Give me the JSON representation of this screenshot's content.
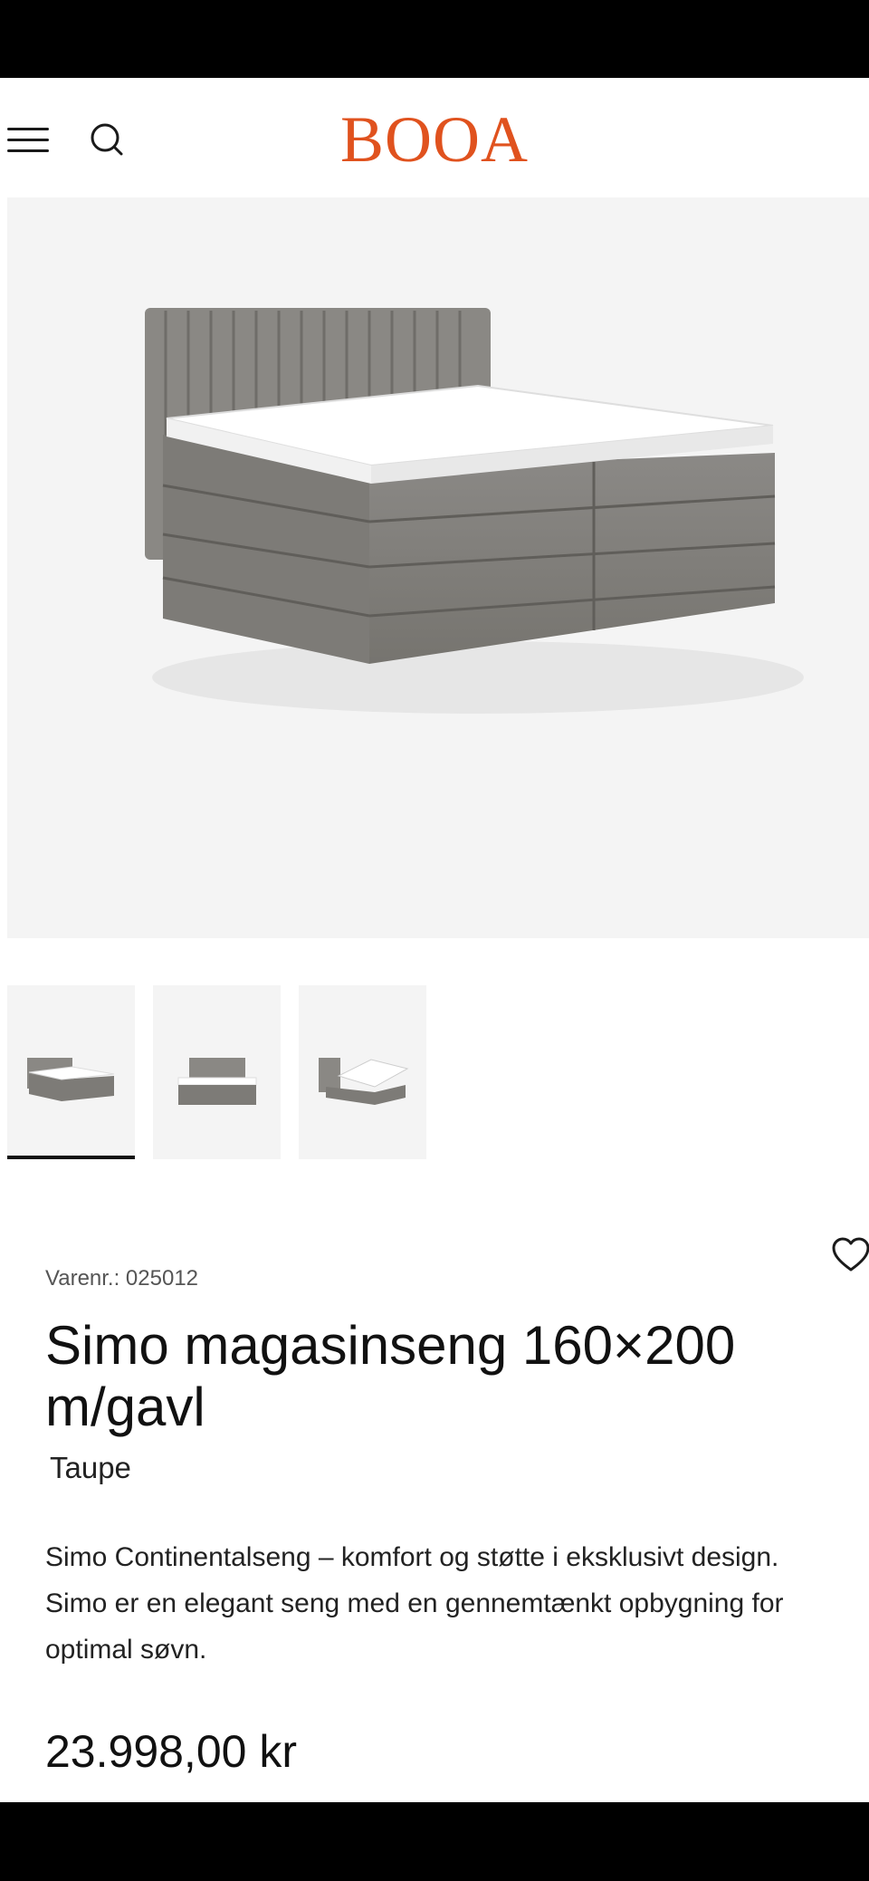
{
  "header": {
    "logo_text": "BOOA",
    "brand_color": "#e0521e",
    "menu_icon": "hamburger-menu-icon",
    "search_icon": "search-icon"
  },
  "gallery": {
    "main_image": "grey upholstered continental bed with vertical channel-tufted headboard, white mattress topper and storage drawers",
    "thumbnails": [
      {
        "description": "bed angled view",
        "active": true
      },
      {
        "description": "bed front view",
        "active": false
      },
      {
        "description": "bed with lifted storage",
        "active": false
      }
    ]
  },
  "product": {
    "sku": "Varenr.: 025012",
    "title": "Simo magasinseng 160×200 m/gavl",
    "variant": "Taupe",
    "description": "Simo Continentalseng – komfort og støtte i eksklusivt design. Simo er en elegant seng med en gennemtænkt opbygning for optimal søvn.",
    "price": "23.998,00 kr",
    "favorite_icon": "heart-icon"
  }
}
